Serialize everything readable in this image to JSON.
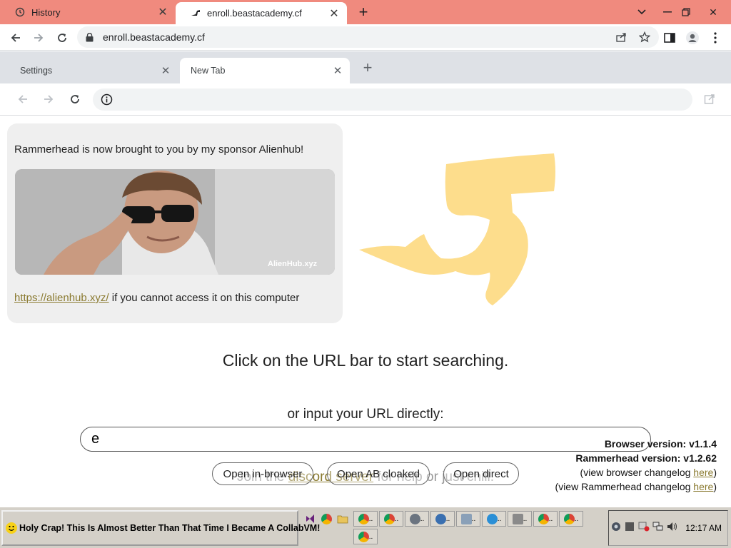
{
  "outer_browser": {
    "tabs": [
      {
        "title": "History",
        "icon": "history-icon"
      },
      {
        "title": "enroll.beastacademy.cf",
        "icon": "rammerhead-favicon",
        "active": true
      }
    ],
    "address": "enroll.beastacademy.cf",
    "colors": {
      "tabstrip": "#f08a7e",
      "toolbar": "#ffffff"
    }
  },
  "inner_browser": {
    "tabs": [
      {
        "title": "Settings"
      },
      {
        "title": "New Tab",
        "active": true
      }
    ],
    "address_value": ""
  },
  "page": {
    "sponsor": {
      "text": "Rammerhead is now brought to you by my sponsor Alienhub!",
      "image_caption": "AlienHub.xyz",
      "link_text": "https://alienhub.xyz/",
      "link_suffix": " if you cannot access it on this computer"
    },
    "headline": "Click on the URL bar to start searching.",
    "subline": "or input your URL directly:",
    "url_input_value": "e",
    "discord": {
      "prefix": "Join the ",
      "link": "discord server",
      "suffix": " for help or just chill."
    },
    "buttons": {
      "open_in_browser": "Open in-browser",
      "open_ab_cloaked": "Open AB cloaked",
      "open_direct": "Open direct"
    },
    "versions": {
      "browser": "Browser version: v1.1.4",
      "rammerhead": "Rammerhead version: v1.2.62",
      "browser_changelog_prefix": "(view browser changelog ",
      "rammerhead_changelog_prefix": "(view Rammerhead changelog ",
      "here": "here",
      "close_paren": ")"
    },
    "colors": {
      "accent": "#8a7a30",
      "logo": "#fddd8c",
      "card": "#efefef"
    }
  },
  "taskbar": {
    "start_label": "Holy Crap! This Is Almost Better Than That Time I Became A CollabVM!",
    "app_labels": [
      ".",
      "..",
      "..",
      "..",
      "..",
      "..",
      "..",
      "..",
      "..",
      "..",
      ".."
    ],
    "clock": "12:17 AM"
  }
}
